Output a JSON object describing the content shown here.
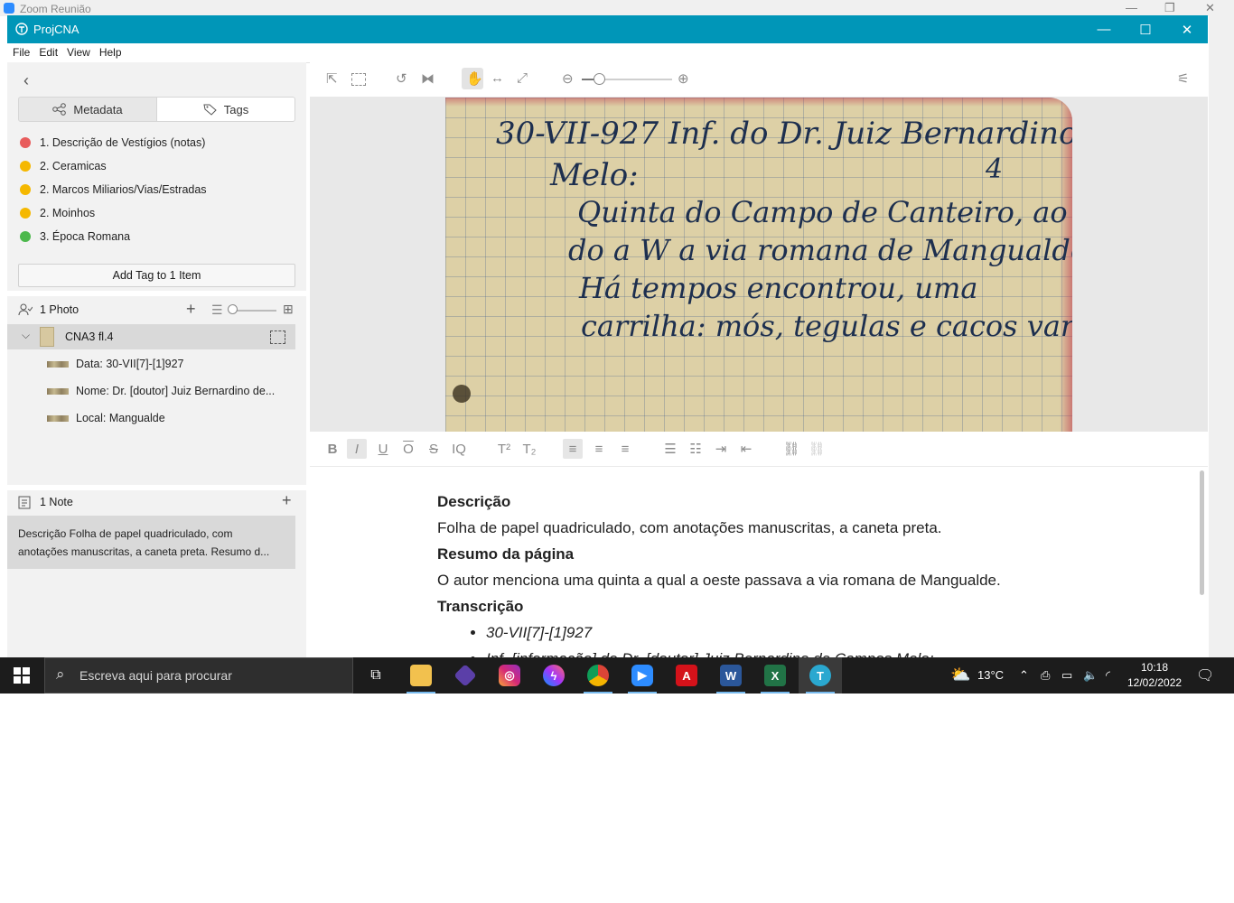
{
  "zoom_window": {
    "title": "Zoom Reunião"
  },
  "app": {
    "title": "ProjCNA",
    "menu": [
      "File",
      "Edit",
      "View",
      "Help"
    ]
  },
  "sidebar": {
    "tabs": {
      "metadata": "Metadata",
      "tags": "Tags"
    },
    "tags": [
      {
        "label": "1. Descrição de Vestígios (notas)",
        "color": "#e85c5c"
      },
      {
        "label": "2. Ceramicas",
        "color": "#f5b800"
      },
      {
        "label": "2. Marcos Miliarios/Vias/Estradas",
        "color": "#f5b800"
      },
      {
        "label": "2. Moinhos",
        "color": "#f5b800"
      },
      {
        "label": "3. Época Romana",
        "color": "#4cb84c"
      }
    ],
    "add_tag_button": "Add Tag to 1 Item",
    "photos": {
      "header": "1 Photo",
      "item": "CNA3 fl.4",
      "subitems": [
        "Data: 30-VII[7]-[1]927",
        "Nome: Dr. [doutor] Juiz Bernardino de...",
        "Local: Mangualde"
      ]
    },
    "notes": {
      "header": "1 Note",
      "preview_line1": "Descrição Folha de papel quadriculado, com",
      "preview_line2": "anotações manuscritas, a caneta preta. Resumo d..."
    }
  },
  "document": {
    "heading1": "Descrição",
    "para1": "Folha de papel quadriculado, com anotações manuscritas, a caneta preta.",
    "heading2": "Resumo da página",
    "para2": "O autor menciona uma quinta a qual a oeste passava a via romana de Mangualde.",
    "heading3": "Transcrição",
    "bullets": [
      "30-VII[7]-[1]927",
      "Inf. [informação] do Dr. [doutor] Juiz Bernardino de Campos Melo;"
    ]
  },
  "taskbar": {
    "search_placeholder": "Escreva aqui para procurar",
    "weather": "13°C",
    "time": "10:18",
    "date": "12/02/2022"
  },
  "colors": {
    "titlebar": "#0096b8",
    "accent": "#0096b8"
  }
}
